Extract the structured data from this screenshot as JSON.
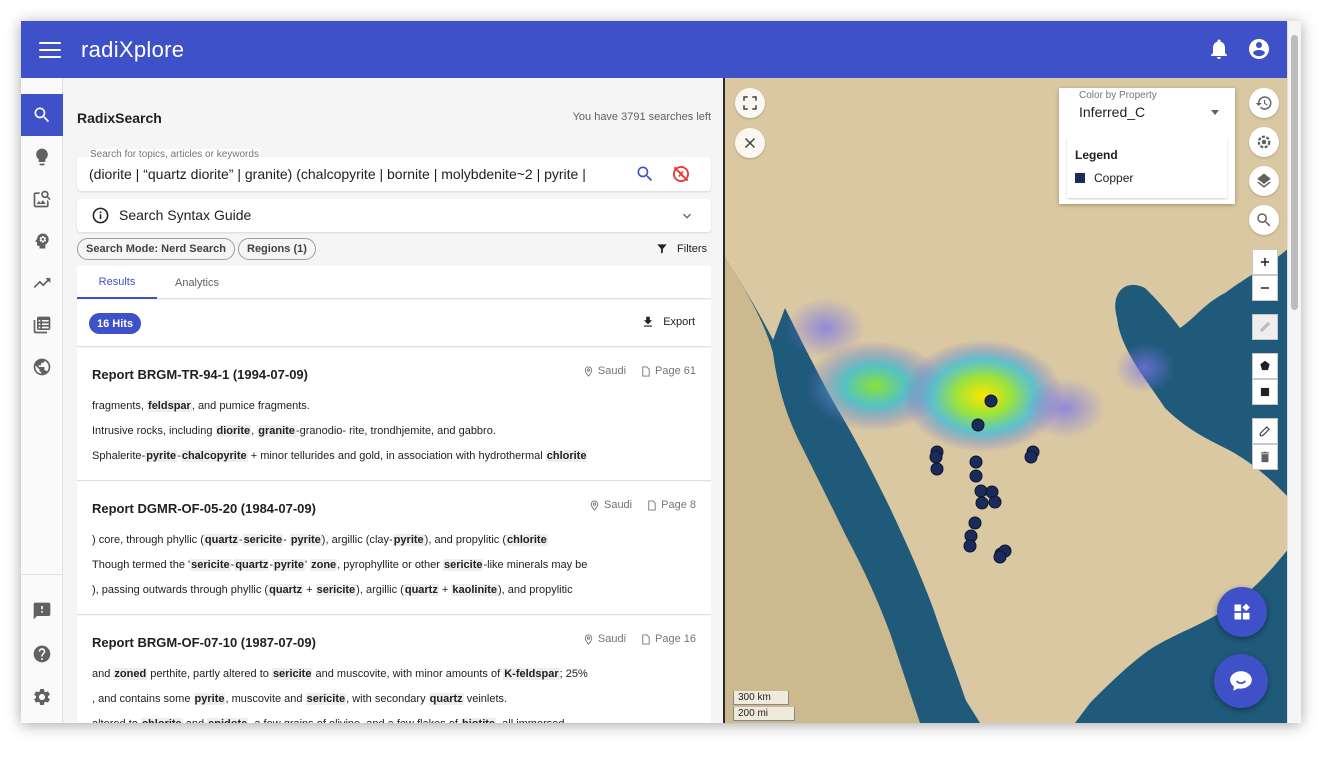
{
  "app": {
    "brand": "radiXplore"
  },
  "header": {
    "notifications_icon": "bell-icon",
    "account_icon": "account-circle-icon"
  },
  "rail": {
    "items": [
      "search-icon",
      "lightbulb-icon",
      "image-search-icon",
      "brain-icon",
      "trending-icon",
      "table-icon",
      "globe-icon"
    ],
    "bottom": [
      "feedback-icon",
      "help-icon",
      "settings-icon"
    ]
  },
  "panel": {
    "title": "RadixSearch",
    "searches_left": "You have 3791 searches left",
    "search": {
      "label": "Search for topics, articles or keywords",
      "value": "(diorite | “quartz diorite” | granite) (chalcopyrite | bornite |  molybdenite~2 |  pyrite |"
    },
    "syntax_guide": "Search Syntax Guide",
    "chips": [
      "Search Mode: Nerd Search",
      "Regions (1)"
    ],
    "filters": "Filters",
    "tabs": [
      "Results",
      "Analytics"
    ],
    "hits": "16 Hits",
    "export": "Export"
  },
  "results": [
    {
      "title": "Report BRGM-TR-94-1 (1994-07-09)",
      "region": "Saudi",
      "page": "Page 61",
      "snippets": [
        [
          [
            "fragments, ",
            false
          ],
          [
            "feldspar",
            true
          ],
          [
            ", and pumice fragments.",
            false
          ]
        ],
        [
          [
            "Intrusive rocks, including ",
            false
          ],
          [
            "diorite",
            true
          ],
          [
            ", ",
            false
          ],
          [
            "granite",
            true
          ],
          [
            "-granodio- rite, trondhjemite, and gabbro.",
            false
          ]
        ],
        [
          [
            "Sphalerite-",
            false
          ],
          [
            "pyrite",
            true
          ],
          [
            "-",
            false
          ],
          [
            "chalcopyrite",
            true
          ],
          [
            " + minor tellurides and gold, in association with hydrothermal ",
            false
          ],
          [
            "chlorite",
            true
          ]
        ]
      ]
    },
    {
      "title": "Report DGMR-OF-05-20 (1984-07-09)",
      "region": "Saudi",
      "page": "Page 8",
      "snippets": [
        [
          [
            ") core, through phyllic (",
            false
          ],
          [
            "quartz",
            true
          ],
          [
            "-",
            false
          ],
          [
            "sericite",
            true
          ],
          [
            "- ",
            false
          ],
          [
            "pyrite",
            true
          ],
          [
            "), argillic (clay-",
            false
          ],
          [
            "pyrite",
            true
          ],
          [
            "), and propylitic (",
            false
          ],
          [
            "chlorite",
            true
          ]
        ],
        [
          [
            "Though termed the '",
            false
          ],
          [
            "sericite",
            true
          ],
          [
            "-",
            false
          ],
          [
            "quartz",
            true
          ],
          [
            "-",
            false
          ],
          [
            "pyrite",
            true
          ],
          [
            "' ",
            false
          ],
          [
            "zone",
            true
          ],
          [
            ", pyrophyllite or other ",
            false
          ],
          [
            "sericite",
            true
          ],
          [
            "-like minerals may be",
            false
          ]
        ],
        [
          [
            "), passing outwards through phyllic (",
            false
          ],
          [
            "quartz",
            true
          ],
          [
            " + ",
            false
          ],
          [
            "sericite",
            true
          ],
          [
            "), argillic (",
            false
          ],
          [
            "quartz",
            true
          ],
          [
            " + ",
            false
          ],
          [
            "kaolinite",
            true
          ],
          [
            "), and propylitic",
            false
          ]
        ]
      ]
    },
    {
      "title": "Report BRGM-OF-07-10 (1987-07-09)",
      "region": "Saudi",
      "page": "Page 16",
      "snippets": [
        [
          [
            "and ",
            false
          ],
          [
            "zoned",
            true
          ],
          [
            " perthite, partly altered to ",
            false
          ],
          [
            "sericite",
            true
          ],
          [
            " and muscovite, with minor amounts of ",
            false
          ],
          [
            "K-feldspar",
            true
          ],
          [
            "; 25%",
            false
          ]
        ],
        [
          [
            ", and contains some ",
            false
          ],
          [
            "pyrite",
            true
          ],
          [
            ", muscovite and ",
            false
          ],
          [
            "sericite",
            true
          ],
          [
            ", with secondary ",
            false
          ],
          [
            "quartz",
            true
          ],
          [
            " veinlets.",
            false
          ]
        ],
        [
          [
            "altered to ",
            false
          ],
          [
            "chlorite",
            true
          ],
          [
            " and ",
            false
          ],
          [
            "epidote",
            true
          ],
          [
            ", a few grains of olivine, and a few flakes of ",
            false
          ],
          [
            "biotite",
            true
          ],
          [
            ", all immersed",
            false
          ]
        ]
      ]
    }
  ],
  "map": {
    "color_by": {
      "label": "Color by Property",
      "value": "Inferred_C"
    },
    "legend": {
      "title": "Legend",
      "items": [
        {
          "label": "Copper",
          "color": "#1a2b5a"
        }
      ]
    },
    "scale": [
      "300 km",
      "200 mi"
    ],
    "controls": [
      "history-icon",
      "settings-icon",
      "layers-icon",
      "search-icon",
      "zoom-in-icon",
      "zoom-out-icon",
      "ruler-icon",
      "polygon-icon",
      "rectangle-icon",
      "edit-icon",
      "delete-icon"
    ],
    "colors": {
      "sea": "#1f5a7a",
      "land": "#d9c8a2",
      "marker": "#1a2b5a",
      "accent": "#3f51c8"
    }
  }
}
